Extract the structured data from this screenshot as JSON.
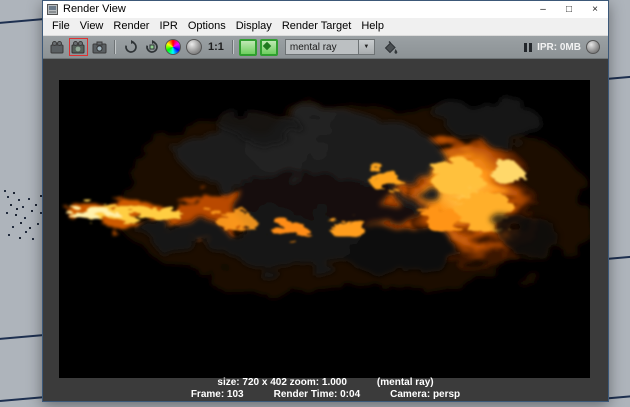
{
  "window": {
    "title": "Render View",
    "minimize_glyph": "–",
    "maximize_glyph": "□",
    "close_glyph": "×"
  },
  "menu": {
    "items": [
      "File",
      "View",
      "Render",
      "IPR",
      "Options",
      "Display",
      "Render Target",
      "Help"
    ]
  },
  "toolbar": {
    "one_to_one_label": "1:1",
    "renderer": "mental ray",
    "dropdown_arrow": "▼",
    "ipr_memory_label": "IPR: 0MB"
  },
  "status": {
    "size_zoom": "size: 720 x 402 zoom: 1.000",
    "renderer_note": "(mental ray)",
    "frame": "Frame: 103",
    "render_time": "Render Time: 0:04",
    "camera": "Camera: persp"
  },
  "colors": {
    "selection_red": "#e03030",
    "icon_green": "#2f9e2f",
    "fire_core": "#ffd24a",
    "fire_mid": "#ff9416",
    "smoke": "#1a1a1a",
    "background": "#aeb4bb"
  }
}
